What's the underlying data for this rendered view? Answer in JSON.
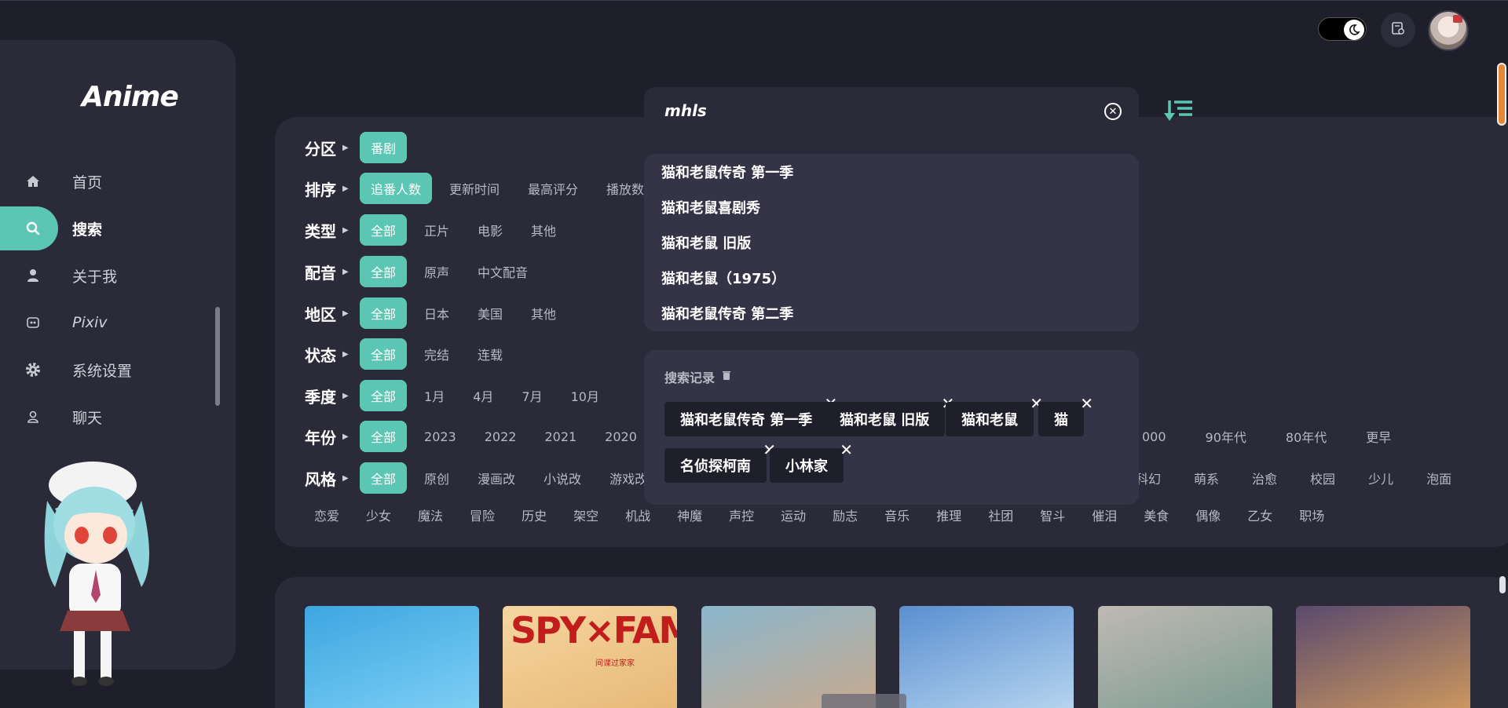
{
  "app": {
    "logo": "Anime"
  },
  "header": {
    "theme_toggle": "dark-mode",
    "history_icon": "calendar-icon"
  },
  "sidebar": {
    "items": [
      {
        "label": "首页",
        "icon": "home-icon",
        "active": false
      },
      {
        "label": "搜索",
        "icon": "search-icon",
        "active": true
      },
      {
        "label": "关于我",
        "icon": "user-icon",
        "active": false
      },
      {
        "label": "Pixiv",
        "icon": "pixiv-icon",
        "active": false
      },
      {
        "label": "系统设置",
        "icon": "gear-icon",
        "active": false
      },
      {
        "label": "聊天",
        "icon": "chat-user-icon",
        "active": false
      }
    ]
  },
  "filters": {
    "partition": {
      "label": "分区",
      "options": [
        "番剧"
      ]
    },
    "sort": {
      "label": "排序",
      "options": [
        "追番人数",
        "更新时间",
        "最高评分",
        "播放数量"
      ]
    },
    "type": {
      "label": "类型",
      "options": [
        "全部",
        "正片",
        "电影",
        "其他"
      ]
    },
    "dub": {
      "label": "配音",
      "options": [
        "全部",
        "原声",
        "中文配音"
      ]
    },
    "region": {
      "label": "地区",
      "options": [
        "全部",
        "日本",
        "美国",
        "其他"
      ]
    },
    "status": {
      "label": "状态",
      "options": [
        "全部",
        "完结",
        "连载"
      ]
    },
    "season": {
      "label": "季度",
      "options": [
        "全部",
        "1月",
        "4月",
        "7月",
        "10月"
      ]
    },
    "year": {
      "label": "年份",
      "options": [
        "全部",
        "2023",
        "2022",
        "2021",
        "2020"
      ],
      "options_right": [
        "000",
        "90年代",
        "80年代",
        "更早"
      ]
    },
    "style": {
      "label": "风格",
      "options": [
        "全部",
        "原创",
        "漫画改",
        "小说改",
        "游戏改"
      ],
      "options_right": [
        "科幻",
        "萌系",
        "治愈",
        "校园",
        "少儿",
        "泡面"
      ],
      "options_row2": [
        "恋爱",
        "少女",
        "魔法",
        "冒险",
        "历史",
        "架空",
        "机战",
        "神魔",
        "声控",
        "运动",
        "励志",
        "音乐",
        "推理",
        "社团",
        "智斗",
        "催泪",
        "美食",
        "偶像",
        "乙女",
        "职场"
      ]
    }
  },
  "search": {
    "value": "mhls",
    "suggestions": [
      "猫和老鼠传奇 第一季",
      "猫和老鼠喜剧秀",
      "猫和老鼠 旧版",
      "猫和老鼠（1975）",
      "猫和老鼠传奇 第二季"
    ],
    "history_title": "搜索记录",
    "history": [
      "猫和老鼠传奇 第一季",
      "猫和老鼠 旧版",
      "猫和老鼠",
      "猫",
      "名侦探柯南",
      "小林家"
    ]
  },
  "results": {
    "cards": [
      {
        "colors": [
          "#3da6e0",
          "#7fd0f5"
        ]
      },
      {
        "title": "SPY×FAMILY",
        "subtitle": "间谍过家家",
        "colors": [
          "#f5d6a0",
          "#e7b775"
        ]
      },
      {
        "colors": [
          "#8ab6cc",
          "#c9a98c"
        ]
      },
      {
        "colors": [
          "#5a8fd0",
          "#b9d7f0"
        ]
      },
      {
        "colors": [
          "#bfb9b3",
          "#7a9b91"
        ]
      },
      {
        "colors": [
          "#5a4a6d",
          "#d09a5e"
        ]
      }
    ]
  }
}
